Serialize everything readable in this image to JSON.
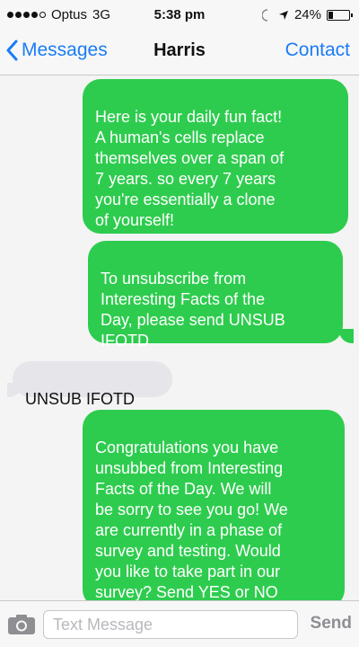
{
  "status_bar": {
    "carrier": "Optus",
    "network": "3G",
    "time": "5:38 pm",
    "battery_text": "24%",
    "battery_level": 0.24
  },
  "nav": {
    "back_label": "Messages",
    "title": "Harris",
    "contact_label": "Contact"
  },
  "messages": [
    {
      "direction": "outgoing",
      "text": "Here is your daily fun fact!\nA human's cells replace\nthemselves over a span of\n7 years. so every 7 years\nyou're essentially a clone\nof yourself!"
    },
    {
      "direction": "outgoing",
      "text": "To unsubscribe from\nInteresting Facts of the\nDay, please send UNSUB\nIFOTD"
    },
    {
      "direction": "incoming",
      "text": "UNSUB IFOTD"
    },
    {
      "direction": "outgoing",
      "text": "Congratulations you have\nunsubbed from Interesting\nFacts of the Day. We will\nbe sorry to see you go! We\nare currently in a phase of\nsurvey and testing. Would\nyou like to take part in our\nsurvey? Send YES or NO"
    }
  ],
  "input": {
    "placeholder": "Text Message",
    "value": "",
    "send_label": "Send"
  },
  "colors": {
    "outgoing_bubble": "#2ecc4e",
    "incoming_bubble": "#e5e5ea",
    "accent": "#1a7cf5"
  },
  "icons": {
    "back": "chevron-left-icon",
    "camera": "camera-icon",
    "location": "location-arrow-icon",
    "alarm": "alarm-icon",
    "battery": "battery-icon"
  }
}
